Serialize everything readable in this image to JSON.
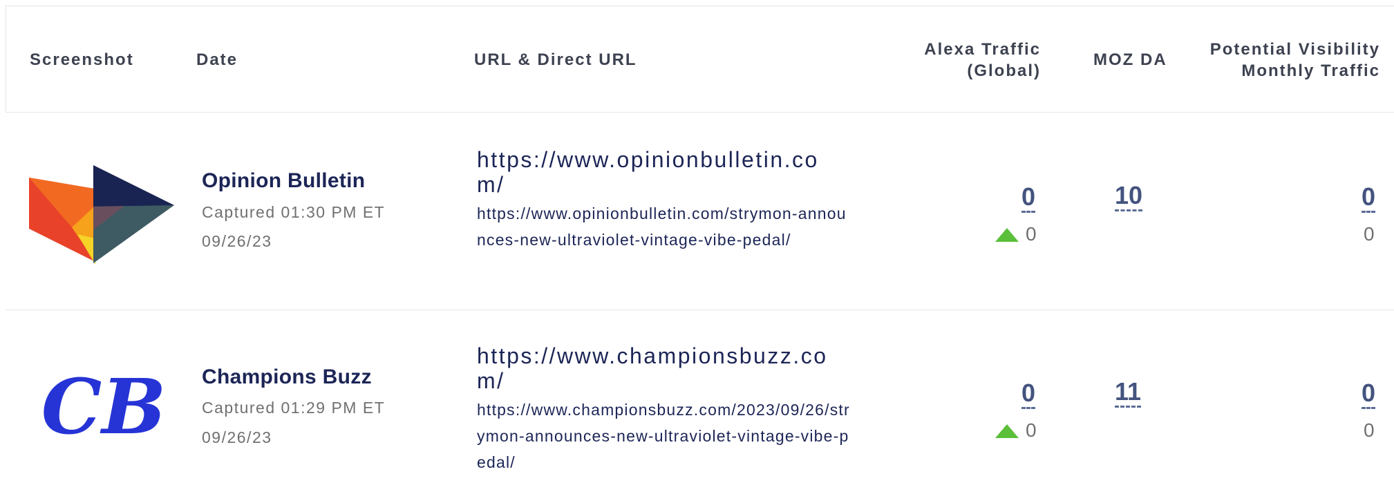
{
  "headers": {
    "screenshot": "Screenshot",
    "date": "Date",
    "url": "URL & Direct URL",
    "alexa_line1": "Alexa Traffic",
    "alexa_line2": "(Global)",
    "moz": "MOZ DA",
    "visibility_line1": "Potential Visibility",
    "visibility_line2": "Monthly Traffic"
  },
  "rows": [
    {
      "logo_icon": "opinion-bulletin-logo",
      "site_name": "Opinion Bulletin",
      "captured": "Captured 01:30 PM ET",
      "date": "09/26/23",
      "url": "https://www.opinionbulletin.com/",
      "direct_url": "https://www.opinionbulletin.com/strymon-announces-new-ultraviolet-vintage-vibe-pedal/",
      "alexa_value": "0",
      "alexa_change": "0",
      "moz_da": "10",
      "visibility_value": "0",
      "visibility_sub": "0"
    },
    {
      "logo_icon": "champions-buzz-logo",
      "logo_text": "CB",
      "site_name": "Champions Buzz",
      "captured": "Captured 01:29 PM ET",
      "date": "09/26/23",
      "url": "https://www.championsbuzz.com/",
      "direct_url": "https://www.championsbuzz.com/2023/09/26/strymon-announces-new-ultraviolet-vintage-vibe-pedal/",
      "alexa_value": "0",
      "alexa_change": "0",
      "moz_da": "11",
      "visibility_value": "0",
      "visibility_sub": "0"
    }
  ],
  "colors": {
    "navy": "#1c2556",
    "link": "#44537e",
    "green_arrow": "#5bbf3a",
    "grey_text": "#707070"
  }
}
